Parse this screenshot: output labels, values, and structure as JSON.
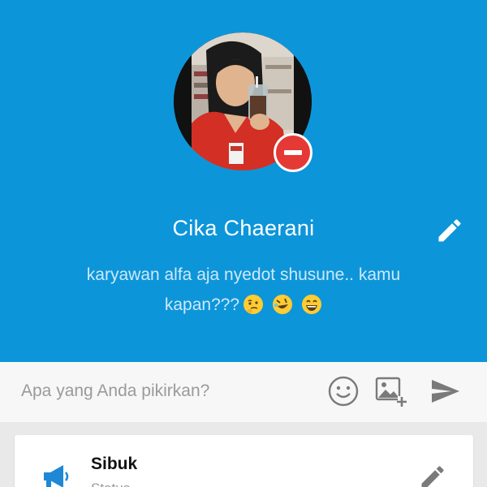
{
  "profile": {
    "name": "Cika Chaerani",
    "status_text": "karyawan alfa aja nyedot shusune.. kamu kapan???",
    "status_emojis": [
      "thinking-face",
      "rolling-on-floor-laughing",
      "grinning-squinting-face"
    ],
    "avatar_icon": "profile-photo",
    "remove_photo_icon": "minus-icon",
    "edit_icon": "pencil-icon"
  },
  "composer": {
    "placeholder": "Apa yang Anda pikirkan?",
    "emoji_icon": "smiley-icon",
    "image_icon": "add-image-icon",
    "send_icon": "send-icon"
  },
  "availability": {
    "title": "Sibuk",
    "subtitle": "Status",
    "icon": "megaphone-icon",
    "edit_icon": "pencil-icon"
  },
  "colors": {
    "header_bg": "#0d95da",
    "remove_badge": "#e53935",
    "icon_gray": "#7a7a7a",
    "megaphone_blue": "#1e88d6"
  }
}
